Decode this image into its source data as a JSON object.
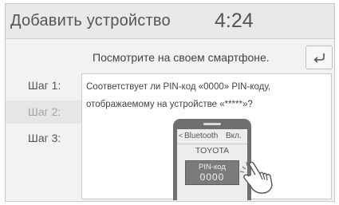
{
  "header": {
    "title": "Добавить устройство",
    "clock": "4:24"
  },
  "instruction": "Посмотрите на своем смартфоне.",
  "back_icon": "back-arrow-icon",
  "steps": [
    {
      "label": "Шаг 1:",
      "state": "current"
    },
    {
      "label": "Шаг 2:",
      "state": "inactive"
    },
    {
      "label": "Шаг 3:",
      "state": "normal"
    }
  ],
  "question": "Соответствует ли PIN-код «0000» PIN-коду, отображаемому на устройстве «*****»?",
  "phone": {
    "bluetooth_label": "Bluetooth",
    "bluetooth_state": "Вкл.",
    "device_name": "TOYOTA",
    "pin_label": "PIN-код",
    "pin_code": "0000"
  },
  "colors": {
    "screen_bg": "#f2f2f2",
    "header_bg": "#e9e9e9",
    "text": "#505050",
    "phone_body": "#6f6f6f",
    "pin_box": "#7b7b7b"
  }
}
